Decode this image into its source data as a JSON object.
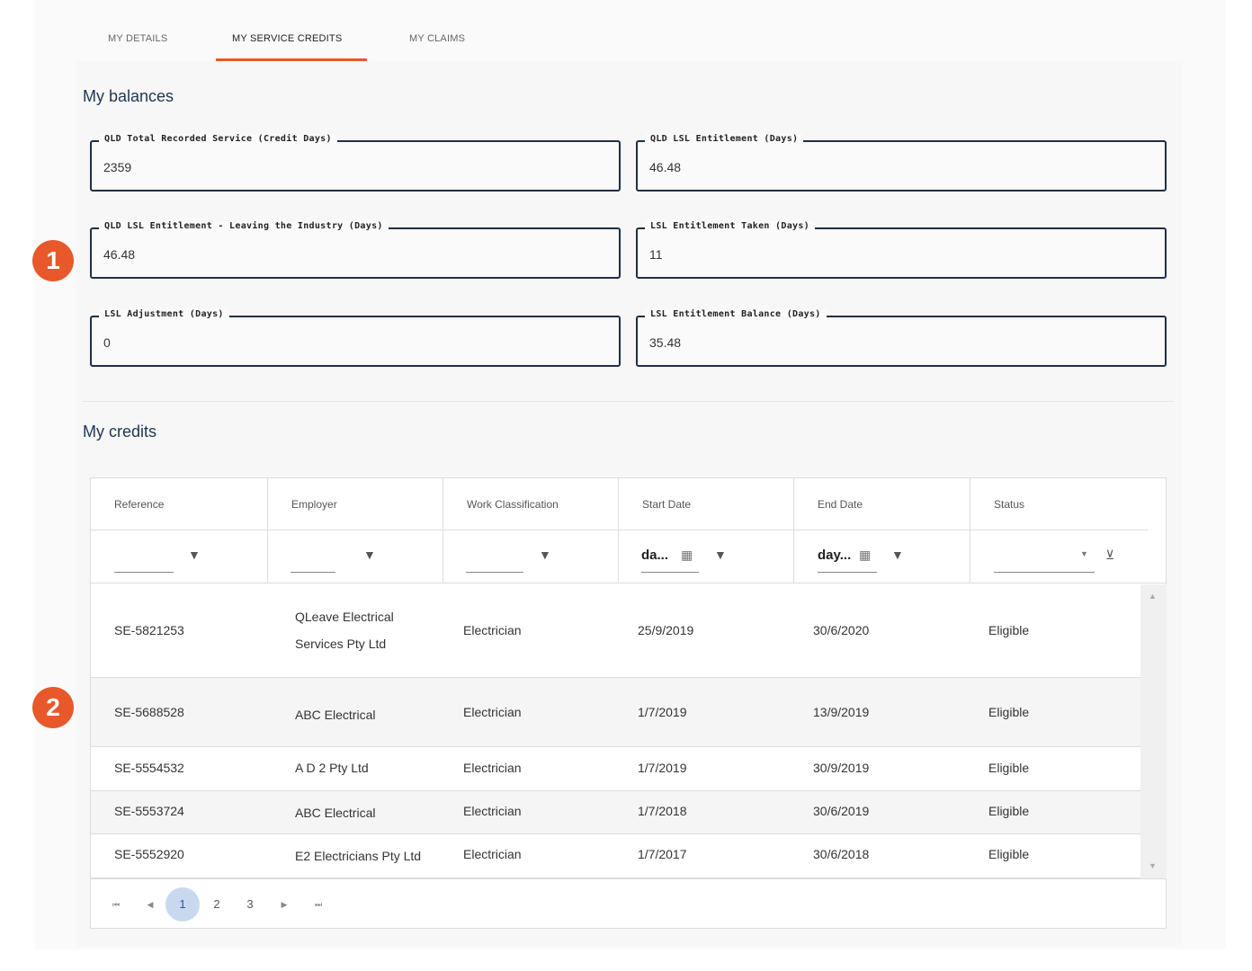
{
  "tabs": [
    {
      "label": "MY DETAILS"
    },
    {
      "label": "MY SERVICE CREDITS"
    },
    {
      "label": "MY CLAIMS"
    }
  ],
  "balances": {
    "title": "My balances",
    "fields": [
      {
        "label": "QLD Total Recorded Service (Credit Days)",
        "value": "2359"
      },
      {
        "label": "QLD LSL Entitlement (Days)",
        "value": "46.48"
      },
      {
        "label": "QLD LSL Entitlement - Leaving the Industry (Days)",
        "value": "46.48"
      },
      {
        "label": "LSL Entitlement Taken (Days)",
        "value": "11"
      },
      {
        "label": "LSL Adjustment (Days)",
        "value": "0"
      },
      {
        "label": "LSL Entitlement Balance (Days)",
        "value": "35.48"
      }
    ]
  },
  "credits": {
    "title": "My credits",
    "columns": [
      "Reference",
      "Employer",
      "Work Classification",
      "Start Date",
      "End Date",
      "Status"
    ],
    "filters": {
      "start_date": "da...",
      "end_date": "day..."
    },
    "rows": [
      {
        "reference": "SE-5821253",
        "employer_line1": "QLeave Electrical",
        "employer_line2": "Services Pty Ltd",
        "classification": "Electrician",
        "start": "25/9/2019",
        "end": "30/6/2020",
        "status": "Eligible"
      },
      {
        "reference": "SE-5688528",
        "employer_line1": "ABC Electrical",
        "employer_line2": "",
        "classification": "Electrician",
        "start": "1/7/2019",
        "end": "13/9/2019",
        "status": "Eligible"
      },
      {
        "reference": "SE-5554532",
        "employer_line1": "A D 2 Pty Ltd",
        "employer_line2": "",
        "classification": "Electrician",
        "start": "1/7/2019",
        "end": "30/9/2019",
        "status": "Eligible"
      },
      {
        "reference": "SE-5553724",
        "employer_line1": "ABC Electrical",
        "employer_line2": "",
        "classification": "Electrician",
        "start": "1/7/2018",
        "end": "30/6/2019",
        "status": "Eligible"
      },
      {
        "reference": "SE-5552920",
        "employer_line1": "E2 Electricians Pty Ltd",
        "employer_line2": "",
        "classification": "Electrician",
        "start": "1/7/2017",
        "end": "30/6/2018",
        "status": "Eligible"
      }
    ],
    "pager": {
      "pages": [
        "1",
        "2",
        "3"
      ],
      "current": "1"
    }
  },
  "badges": [
    "1",
    "2"
  ],
  "colors": {
    "accent": "#e8582b",
    "field_border": "#1f2f45",
    "active_page": "#c8d8ef"
  }
}
